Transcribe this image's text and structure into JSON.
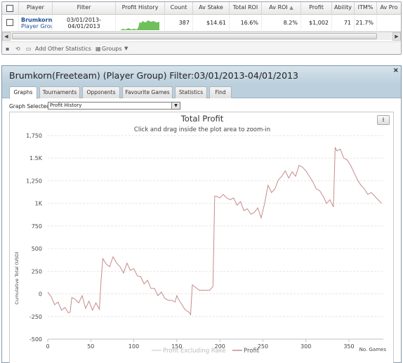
{
  "grid": {
    "columns": [
      "Player",
      "Filter",
      "Profit History",
      "Count",
      "Av Stake",
      "Total ROI",
      "Av ROI",
      "Profit",
      "Ability",
      "ITM%",
      "Av Pro"
    ],
    "row": {
      "player_name": "Brumkorn",
      "player_group": "Player Grou",
      "filter_line1": "03/01/2013-",
      "filter_line2": "04/01/2013",
      "count": "387",
      "av_stake": "$14.61",
      "total_roi": "16.6%",
      "av_roi": "8.2%",
      "profit": "$1,002",
      "ability": "71",
      "itm": "21.7%"
    }
  },
  "toolbar": {
    "add_stats": "Add Other Statistics",
    "groups": "Groups"
  },
  "window": {
    "title": "Brumkorn(Freeteam) (Player Group) Filter:03/01/2013-04/01/2013",
    "close_icon": "×",
    "tabs": [
      "Graphs",
      "Tournaments",
      "Opponents",
      "Favourite Games",
      "Statistics",
      "Find"
    ],
    "active_tab": "Graphs",
    "graph_selected_label": "Graph Selected:",
    "graph_selected_value": "Profit History"
  },
  "chart_data": {
    "type": "line",
    "title": "Total Profit",
    "subtitle": "Click and drag inside the plot area to zoom-in",
    "ylabel": "Cumulative Total (USD)",
    "xlabel": "No. Games",
    "xlim": [
      0,
      390
    ],
    "ylim": [
      -500,
      1750
    ],
    "x_ticks": [
      0,
      50,
      100,
      150,
      200,
      250,
      300,
      350
    ],
    "y_ticks": [
      -500,
      -250,
      0,
      250,
      500,
      750,
      1000,
      1250,
      1500,
      1750
    ],
    "y_tick_labels": [
      "-500",
      "-250",
      "0",
      "250",
      "500",
      "750",
      "1K",
      "1,250",
      "1.5K",
      "1,750"
    ],
    "grid": true,
    "legend_position": "bottom",
    "series": [
      {
        "name": "Profit Excluding Rake",
        "color": "#d9d9d9",
        "values": []
      },
      {
        "name": "Profit",
        "color": "#c78b8b",
        "x": [
          0,
          4,
          8,
          12,
          16,
          20,
          24,
          26,
          28,
          32,
          36,
          40,
          44,
          48,
          52,
          56,
          60,
          62,
          64,
          68,
          72,
          74,
          76,
          80,
          84,
          88,
          92,
          96,
          100,
          104,
          108,
          112,
          116,
          120,
          124,
          128,
          132,
          136,
          140,
          144,
          148,
          150,
          152,
          156,
          160,
          164,
          166,
          168,
          172,
          176,
          180,
          184,
          188,
          192,
          194,
          196,
          200,
          204,
          208,
          212,
          216,
          220,
          224,
          228,
          232,
          236,
          240,
          244,
          248,
          252,
          256,
          260,
          264,
          268,
          272,
          276,
          280,
          284,
          288,
          292,
          296,
          300,
          304,
          308,
          312,
          316,
          320,
          324,
          328,
          332,
          334,
          336,
          340,
          344,
          348,
          352,
          356,
          360,
          364,
          368,
          372,
          376,
          380,
          384,
          388
        ],
        "values": [
          20,
          -30,
          -120,
          -90,
          -180,
          -150,
          -210,
          -200,
          -40,
          -60,
          -100,
          -20,
          -160,
          -80,
          -180,
          -100,
          -170,
          150,
          390,
          330,
          300,
          360,
          410,
          340,
          300,
          230,
          340,
          260,
          280,
          200,
          190,
          110,
          150,
          60,
          60,
          -20,
          20,
          -50,
          -70,
          -70,
          -90,
          -20,
          -60,
          -120,
          -180,
          -200,
          -230,
          100,
          70,
          40,
          40,
          40,
          40,
          80,
          1080,
          1080,
          1060,
          1100,
          1060,
          1040,
          1060,
          980,
          1020,
          920,
          940,
          880,
          900,
          950,
          840,
          1000,
          1200,
          1120,
          1160,
          1260,
          1300,
          1360,
          1280,
          1350,
          1300,
          1420,
          1400,
          1360,
          1300,
          1240,
          1160,
          1140,
          1080,
          1000,
          1040,
          960,
          1620,
          1580,
          1600,
          1500,
          1480,
          1420,
          1340,
          1260,
          1200,
          1160,
          1100,
          1120,
          1080,
          1040,
          1000
        ]
      }
    ]
  }
}
